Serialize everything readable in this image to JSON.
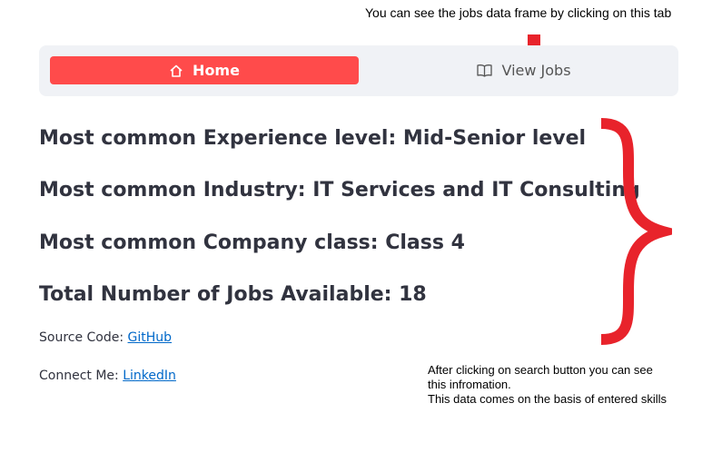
{
  "annotations": {
    "top_note": "You can see the jobs data frame by clicking on this tab",
    "bottom_note_lines": [
      "After clicking on search button you can see",
      "this infromation.",
      "This data comes on the basis of entered skills"
    ],
    "annotation_color": "#e8232b"
  },
  "nav": {
    "tabs": [
      {
        "label": "Home",
        "icon": "house-icon",
        "active": true
      },
      {
        "label": "View Jobs",
        "icon": "book-icon",
        "active": false
      }
    ],
    "active_color": "#ff4b4b",
    "background_color": "#f0f2f6"
  },
  "stats": {
    "experience": "Most common Experience level: Mid-Senior level",
    "industry": "Most common Industry: IT Services and IT Consulting",
    "company_class": "Most common Company class: Class 4",
    "total_jobs": "Total Number of Jobs Available: 18"
  },
  "links": {
    "source_prefix": "Source Code: ",
    "source_link": "GitHub",
    "connect_prefix": "Connect Me: ",
    "connect_link": "LinkedIn",
    "link_color": "#0068c9"
  }
}
